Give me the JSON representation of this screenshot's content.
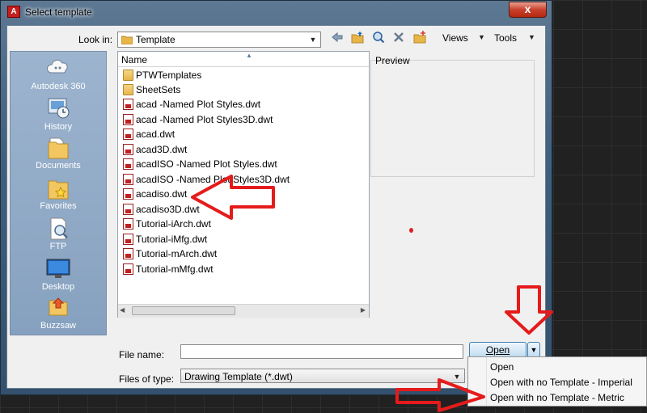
{
  "window": {
    "title": "Select template",
    "close_label": "x"
  },
  "toolbar": {
    "look_in_label": "Look in:",
    "look_in_value": "Template",
    "views_label": "Views",
    "tools_label": "Tools",
    "icons": [
      "back-icon",
      "up-folder-icon",
      "search-web-icon",
      "delete-icon",
      "new-folder-icon"
    ]
  },
  "places": [
    {
      "label": "Autodesk 360",
      "icon": "cloud-icon"
    },
    {
      "label": "History",
      "icon": "history-icon"
    },
    {
      "label": "Documents",
      "icon": "documents-folder-icon"
    },
    {
      "label": "Favorites",
      "icon": "favorites-folder-icon"
    },
    {
      "label": "FTP",
      "icon": "ftp-icon"
    },
    {
      "label": "Desktop",
      "icon": "desktop-icon"
    },
    {
      "label": "Buzzsaw",
      "icon": "buzzsaw-icon"
    }
  ],
  "file_list": {
    "column_header": "Name",
    "items": [
      {
        "name": "PTWTemplates",
        "type": "folder"
      },
      {
        "name": "SheetSets",
        "type": "folder"
      },
      {
        "name": "acad -Named Plot Styles.dwt",
        "type": "dwt"
      },
      {
        "name": "acad -Named Plot Styles3D.dwt",
        "type": "dwt"
      },
      {
        "name": "acad.dwt",
        "type": "dwt"
      },
      {
        "name": "acad3D.dwt",
        "type": "dwt"
      },
      {
        "name": "acadISO -Named Plot Styles.dwt",
        "type": "dwt"
      },
      {
        "name": "acadISO -Named Plot Styles3D.dwt",
        "type": "dwt"
      },
      {
        "name": "acadiso.dwt",
        "type": "dwt"
      },
      {
        "name": "acadiso3D.dwt",
        "type": "dwt"
      },
      {
        "name": "Tutorial-iArch.dwt",
        "type": "dwt"
      },
      {
        "name": "Tutorial-iMfg.dwt",
        "type": "dwt"
      },
      {
        "name": "Tutorial-mArch.dwt",
        "type": "dwt"
      },
      {
        "name": "Tutorial-mMfg.dwt",
        "type": "dwt"
      }
    ]
  },
  "preview": {
    "label": "Preview"
  },
  "form": {
    "file_name_label": "File name:",
    "file_name_value": "",
    "files_of_type_label": "Files of type:",
    "files_of_type_value": "Drawing Template (*.dwt)"
  },
  "buttons": {
    "open_label": "Open"
  },
  "open_menu": {
    "items": [
      "Open",
      "Open with no Template - Imperial",
      "Open with no Template - Metric"
    ]
  },
  "colors": {
    "annotation_red": "#e51b1b",
    "accent_blue": "#3c7fb1",
    "places_bg": "#9db4cf"
  }
}
